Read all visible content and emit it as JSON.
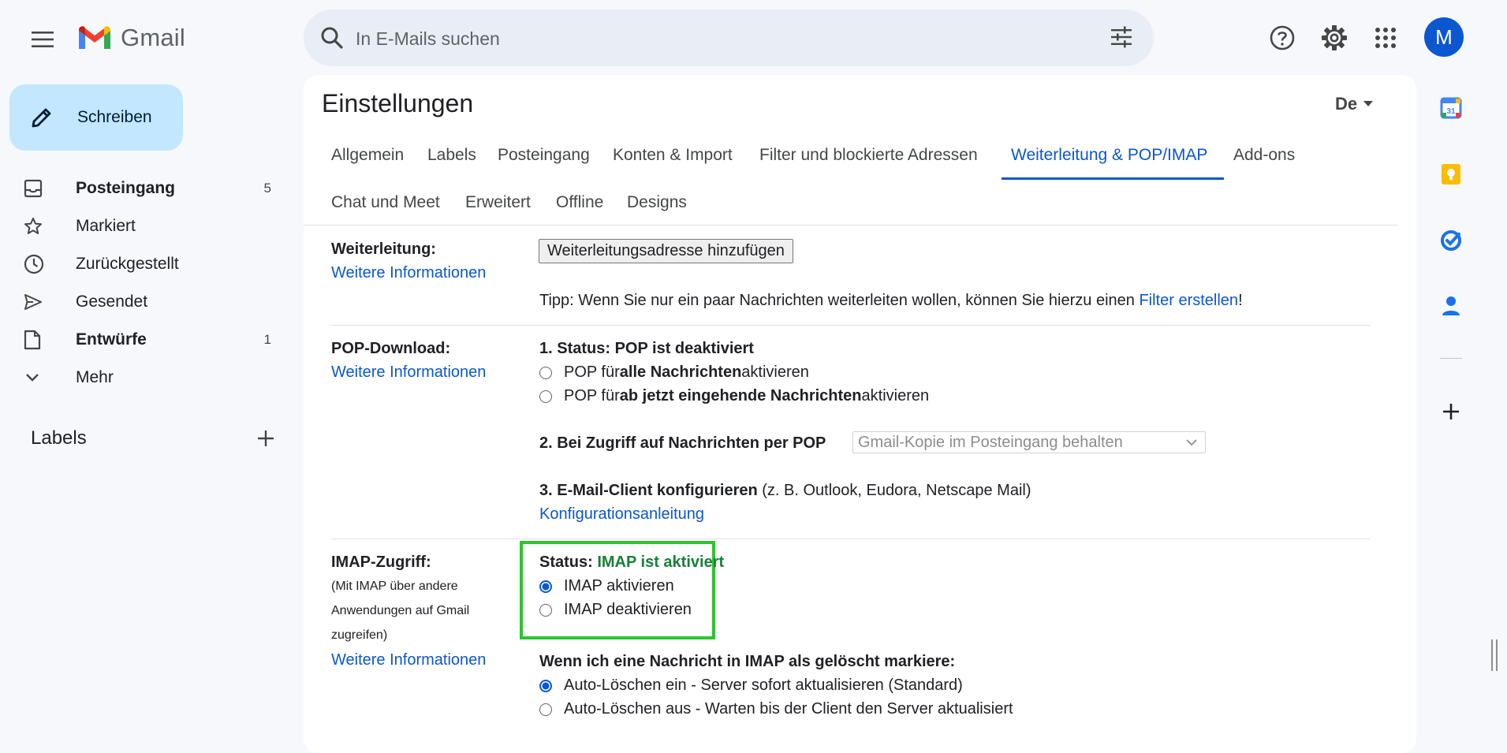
{
  "app": {
    "name": "Gmail"
  },
  "search": {
    "placeholder": "In E-Mails suchen"
  },
  "account": {
    "avatar_letter": "M"
  },
  "compose": {
    "label": "Schreiben"
  },
  "sidebar": {
    "items": [
      {
        "label": "Posteingang",
        "count": "5",
        "icon": "inbox-icon"
      },
      {
        "label": "Markiert",
        "count": "",
        "icon": "star-icon"
      },
      {
        "label": "Zurückgestellt",
        "count": "",
        "icon": "clock-icon"
      },
      {
        "label": "Gesendet",
        "count": "",
        "icon": "send-icon"
      },
      {
        "label": "Entwürfe",
        "count": "1",
        "icon": "draft-icon"
      },
      {
        "label": "Mehr",
        "count": "",
        "icon": "chevron-down-icon"
      }
    ],
    "labels_title": "Labels"
  },
  "settings": {
    "title": "Einstellungen",
    "lang_badge": "De",
    "tabs": [
      "Allgemein",
      "Labels",
      "Posteingang",
      "Konten & Import",
      "Filter und blockierte Adressen",
      "Weiterleitung & POP/IMAP",
      "Add-ons",
      "Chat und Meet",
      "Erweitert",
      "Offline",
      "Designs"
    ],
    "active_tab": "Weiterleitung & POP/IMAP",
    "more_info": "Weitere Informationen",
    "forwarding": {
      "label": "Weiterleitung:",
      "button": "Weiterleitungsadresse hinzufügen",
      "tip_prefix": "Tipp: Wenn Sie nur ein paar Nachrichten weiterleiten wollen, können Sie hierzu einen ",
      "tip_link": "Filter erstellen",
      "tip_suffix": "!"
    },
    "pop": {
      "label": "POP-Download:",
      "status": "1. Status: POP ist deaktiviert",
      "opt1_pre": "POP für ",
      "opt1_bold": "alle Nachrichten",
      "opt1_post": " aktivieren",
      "opt2_pre": "POP für ",
      "opt2_bold": "ab jetzt eingehende Nachrichten",
      "opt2_post": " aktivieren",
      "access_label": "2. Bei Zugriff auf Nachrichten per POP",
      "access_select": "Gmail-Kopie im Posteingang behalten",
      "client_bold": "3. E-Mail-Client konfigurieren",
      "client_rest": " (z. B. Outlook, Eudora, Netscape Mail)",
      "config_link": "Konfigurationsanleitung"
    },
    "imap": {
      "label": "IMAP-Zugriff:",
      "desc": "(Mit IMAP über andere Anwendungen auf Gmail zugreifen)",
      "status_prefix": "Status: ",
      "status_value": "IMAP ist aktiviert",
      "enable": "IMAP aktivieren",
      "disable": "IMAP deaktivieren",
      "enabled": true,
      "delete_heading": "Wenn ich eine Nachricht in IMAP als gelöscht markiere:",
      "autodelete_on": "Auto-Löschen ein - Server sofort aktualisieren (Standard)",
      "autodelete_off": "Auto-Löschen aus - Warten bis der Client den Server aktualisiert",
      "autodelete_selected": "on"
    }
  },
  "colors": {
    "accent": "#0b57d0",
    "compose_bg": "#c2e7ff",
    "status_green": "#188038",
    "highlight": "#2ec42e"
  }
}
